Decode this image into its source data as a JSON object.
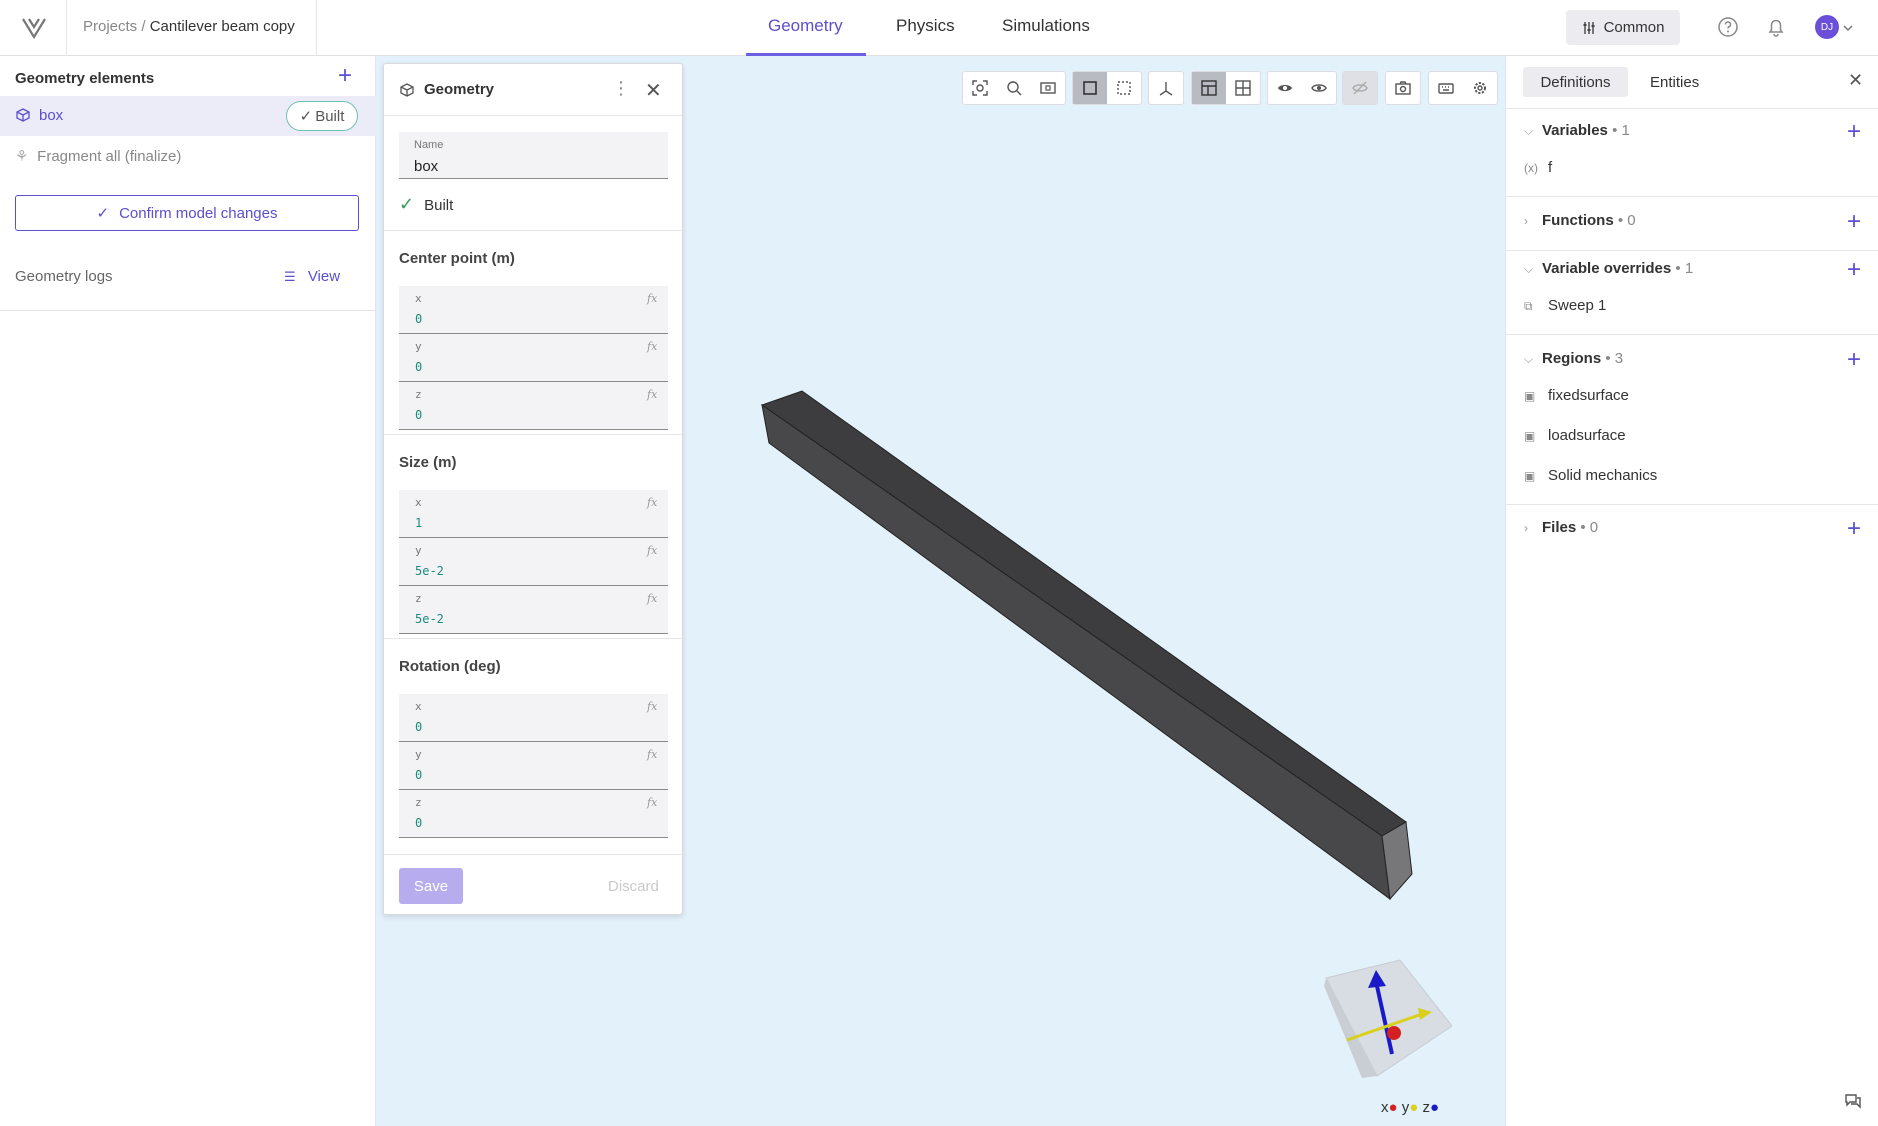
{
  "header": {
    "breadcrumb_root": "Projects /",
    "breadcrumb_current": "Cantilever beam copy",
    "tabs": [
      "Geometry",
      "Physics",
      "Simulations"
    ],
    "active_tab": "Geometry",
    "common_label": "Common",
    "avatar_initials": "DJ"
  },
  "left": {
    "title": "Geometry elements",
    "items": [
      {
        "label": "box",
        "status": "Built",
        "selected": true
      },
      {
        "label": "Fragment all (finalize)",
        "selected": false
      }
    ],
    "confirm_label": "Confirm model changes",
    "logs_label": "Geometry logs",
    "logs_view": "View"
  },
  "geometry_card": {
    "title": "Geometry",
    "name_label": "Name",
    "name_value": "box",
    "status": "Built",
    "sections": [
      {
        "title": "Center point (m)",
        "fields": [
          {
            "label": "x",
            "value": "0"
          },
          {
            "label": "y",
            "value": "0"
          },
          {
            "label": "z",
            "value": "0"
          }
        ]
      },
      {
        "title": "Size (m)",
        "fields": [
          {
            "label": "x",
            "value": "1"
          },
          {
            "label": "y",
            "value": "5e-2"
          },
          {
            "label": "z",
            "value": "5e-2"
          }
        ]
      },
      {
        "title": "Rotation (deg)",
        "fields": [
          {
            "label": "x",
            "value": "0"
          },
          {
            "label": "y",
            "value": "0"
          },
          {
            "label": "z",
            "value": "0"
          }
        ]
      }
    ],
    "fx_label": "fx",
    "save_label": "Save",
    "discard_label": "Discard"
  },
  "axes_legend": {
    "x": "x",
    "y": "y",
    "z": "z"
  },
  "right": {
    "tabs": [
      "Definitions",
      "Entities"
    ],
    "active_tab": "Definitions",
    "sections": [
      {
        "title": "Variables",
        "count": "1",
        "expanded": true,
        "items": [
          "f"
        ]
      },
      {
        "title": "Functions",
        "count": "0",
        "expanded": false,
        "items": []
      },
      {
        "title": "Variable overrides",
        "count": "1",
        "expanded": true,
        "items": [
          "Sweep 1"
        ]
      },
      {
        "title": "Regions",
        "count": "3",
        "expanded": true,
        "items": [
          "fixedsurface",
          "loadsurface",
          "Solid mechanics"
        ]
      },
      {
        "title": "Files",
        "count": "0",
        "expanded": false,
        "items": []
      }
    ]
  },
  "colors": {
    "accent": "#5a4fcf",
    "viewport_bg": "#e3f1fb",
    "beam": "#4a4a4c",
    "built_green": "#2e9c5a"
  }
}
